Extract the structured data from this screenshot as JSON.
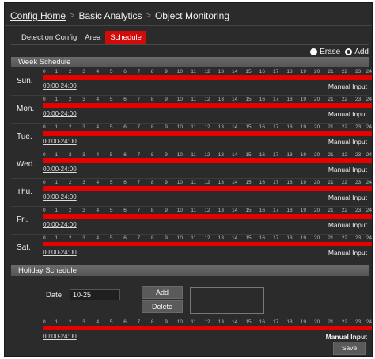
{
  "breadcrumb": {
    "home": "Config Home",
    "items": [
      "Basic Analytics",
      "Object Monitoring"
    ],
    "separator": ">"
  },
  "tabs": [
    {
      "label": "Detection Config",
      "active": false
    },
    {
      "label": "Area",
      "active": false
    },
    {
      "label": "Schedule",
      "active": true
    }
  ],
  "mode": {
    "erase_label": "Erase",
    "add_label": "Add",
    "selected": "Add"
  },
  "week_schedule": {
    "title": "Week Schedule",
    "hours": [
      "0",
      "1",
      "2",
      "3",
      "4",
      "5",
      "6",
      "7",
      "8",
      "9",
      "10",
      "11",
      "12",
      "13",
      "14",
      "15",
      "16",
      "17",
      "18",
      "19",
      "20",
      "21",
      "22",
      "23",
      "24"
    ],
    "days": [
      {
        "label": "Sun.",
        "range": "00:00-24:00",
        "manual": "Manual Input"
      },
      {
        "label": "Mon.",
        "range": "00:00-24:00",
        "manual": "Manual Input"
      },
      {
        "label": "Tue.",
        "range": "00:00-24:00",
        "manual": "Manual Input"
      },
      {
        "label": "Wed.",
        "range": "00:00-24:00",
        "manual": "Manual Input"
      },
      {
        "label": "Thu.",
        "range": "00:00-24:00",
        "manual": "Manual Input"
      },
      {
        "label": "Fri.",
        "range": "00:00-24:00",
        "manual": "Manual Input"
      },
      {
        "label": "Sat.",
        "range": "00:00-24:00",
        "manual": "Manual Input"
      }
    ]
  },
  "holiday_schedule": {
    "title": "Holiday Schedule",
    "date_label": "Date",
    "date_value": "10-25",
    "add_label": "Add",
    "delete_label": "Delete",
    "range": "00:00-24:00",
    "manual": "Manual Input"
  },
  "save_label": "Save",
  "colors": {
    "accent": "#e60000",
    "tab_active": "#d10a0a",
    "background": "#2b2b2b"
  }
}
